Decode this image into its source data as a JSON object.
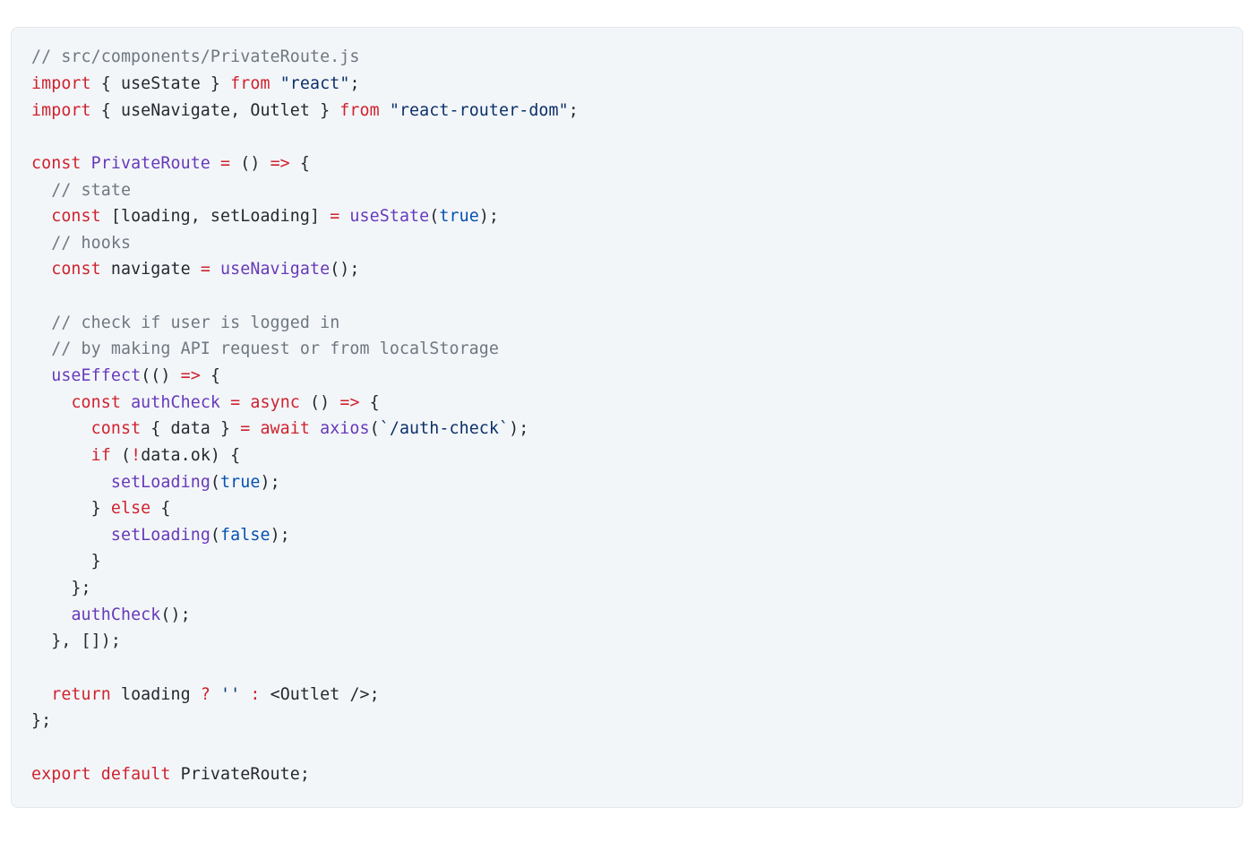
{
  "code": {
    "lines": [
      [
        {
          "cls": "tok-comment",
          "text": "// src/components/PrivateRoute.js"
        }
      ],
      [
        {
          "cls": "tok-keyword",
          "text": "import"
        },
        {
          "cls": "tok-plain",
          "text": " { useState } "
        },
        {
          "cls": "tok-keyword",
          "text": "from"
        },
        {
          "cls": "tok-plain",
          "text": " "
        },
        {
          "cls": "tok-string",
          "text": "\"react\""
        },
        {
          "cls": "tok-plain",
          "text": ";"
        }
      ],
      [
        {
          "cls": "tok-keyword",
          "text": "import"
        },
        {
          "cls": "tok-plain",
          "text": " { useNavigate, Outlet } "
        },
        {
          "cls": "tok-keyword",
          "text": "from"
        },
        {
          "cls": "tok-plain",
          "text": " "
        },
        {
          "cls": "tok-string",
          "text": "\"react-router-dom\""
        },
        {
          "cls": "tok-plain",
          "text": ";"
        }
      ],
      [
        {
          "cls": "tok-plain",
          "text": ""
        }
      ],
      [
        {
          "cls": "tok-keyword",
          "text": "const"
        },
        {
          "cls": "tok-plain",
          "text": " "
        },
        {
          "cls": "tok-func",
          "text": "PrivateRoute"
        },
        {
          "cls": "tok-plain",
          "text": " "
        },
        {
          "cls": "tok-op",
          "text": "="
        },
        {
          "cls": "tok-plain",
          "text": " () "
        },
        {
          "cls": "tok-op",
          "text": "=>"
        },
        {
          "cls": "tok-plain",
          "text": " {"
        }
      ],
      [
        {
          "cls": "tok-plain",
          "text": "  "
        },
        {
          "cls": "tok-comment",
          "text": "// state"
        }
      ],
      [
        {
          "cls": "tok-plain",
          "text": "  "
        },
        {
          "cls": "tok-keyword",
          "text": "const"
        },
        {
          "cls": "tok-plain",
          "text": " [loading, setLoading] "
        },
        {
          "cls": "tok-op",
          "text": "="
        },
        {
          "cls": "tok-plain",
          "text": " "
        },
        {
          "cls": "tok-func",
          "text": "useState"
        },
        {
          "cls": "tok-plain",
          "text": "("
        },
        {
          "cls": "tok-const",
          "text": "true"
        },
        {
          "cls": "tok-plain",
          "text": ");"
        }
      ],
      [
        {
          "cls": "tok-plain",
          "text": "  "
        },
        {
          "cls": "tok-comment",
          "text": "// hooks"
        }
      ],
      [
        {
          "cls": "tok-plain",
          "text": "  "
        },
        {
          "cls": "tok-keyword",
          "text": "const"
        },
        {
          "cls": "tok-plain",
          "text": " navigate "
        },
        {
          "cls": "tok-op",
          "text": "="
        },
        {
          "cls": "tok-plain",
          "text": " "
        },
        {
          "cls": "tok-func",
          "text": "useNavigate"
        },
        {
          "cls": "tok-plain",
          "text": "();"
        }
      ],
      [
        {
          "cls": "tok-plain",
          "text": ""
        }
      ],
      [
        {
          "cls": "tok-plain",
          "text": "  "
        },
        {
          "cls": "tok-comment",
          "text": "// check if user is logged in"
        }
      ],
      [
        {
          "cls": "tok-plain",
          "text": "  "
        },
        {
          "cls": "tok-comment",
          "text": "// by making API request or from localStorage"
        }
      ],
      [
        {
          "cls": "tok-plain",
          "text": "  "
        },
        {
          "cls": "tok-func",
          "text": "useEffect"
        },
        {
          "cls": "tok-plain",
          "text": "(() "
        },
        {
          "cls": "tok-op",
          "text": "=>"
        },
        {
          "cls": "tok-plain",
          "text": " {"
        }
      ],
      [
        {
          "cls": "tok-plain",
          "text": "    "
        },
        {
          "cls": "tok-keyword",
          "text": "const"
        },
        {
          "cls": "tok-plain",
          "text": " "
        },
        {
          "cls": "tok-func",
          "text": "authCheck"
        },
        {
          "cls": "tok-plain",
          "text": " "
        },
        {
          "cls": "tok-op",
          "text": "="
        },
        {
          "cls": "tok-plain",
          "text": " "
        },
        {
          "cls": "tok-keyword",
          "text": "async"
        },
        {
          "cls": "tok-plain",
          "text": " () "
        },
        {
          "cls": "tok-op",
          "text": "=>"
        },
        {
          "cls": "tok-plain",
          "text": " {"
        }
      ],
      [
        {
          "cls": "tok-plain",
          "text": "      "
        },
        {
          "cls": "tok-keyword",
          "text": "const"
        },
        {
          "cls": "tok-plain",
          "text": " { data } "
        },
        {
          "cls": "tok-op",
          "text": "="
        },
        {
          "cls": "tok-plain",
          "text": " "
        },
        {
          "cls": "tok-keyword",
          "text": "await"
        },
        {
          "cls": "tok-plain",
          "text": " "
        },
        {
          "cls": "tok-func",
          "text": "axios"
        },
        {
          "cls": "tok-plain",
          "text": "("
        },
        {
          "cls": "tok-string",
          "text": "`/auth-check`"
        },
        {
          "cls": "tok-plain",
          "text": ");"
        }
      ],
      [
        {
          "cls": "tok-plain",
          "text": "      "
        },
        {
          "cls": "tok-keyword",
          "text": "if"
        },
        {
          "cls": "tok-plain",
          "text": " ("
        },
        {
          "cls": "tok-op",
          "text": "!"
        },
        {
          "cls": "tok-plain",
          "text": "data.ok) {"
        }
      ],
      [
        {
          "cls": "tok-plain",
          "text": "        "
        },
        {
          "cls": "tok-func",
          "text": "setLoading"
        },
        {
          "cls": "tok-plain",
          "text": "("
        },
        {
          "cls": "tok-const",
          "text": "true"
        },
        {
          "cls": "tok-plain",
          "text": ");"
        }
      ],
      [
        {
          "cls": "tok-plain",
          "text": "      } "
        },
        {
          "cls": "tok-keyword",
          "text": "else"
        },
        {
          "cls": "tok-plain",
          "text": " {"
        }
      ],
      [
        {
          "cls": "tok-plain",
          "text": "        "
        },
        {
          "cls": "tok-func",
          "text": "setLoading"
        },
        {
          "cls": "tok-plain",
          "text": "("
        },
        {
          "cls": "tok-const",
          "text": "false"
        },
        {
          "cls": "tok-plain",
          "text": ");"
        }
      ],
      [
        {
          "cls": "tok-plain",
          "text": "      }"
        }
      ],
      [
        {
          "cls": "tok-plain",
          "text": "    };"
        }
      ],
      [
        {
          "cls": "tok-plain",
          "text": "    "
        },
        {
          "cls": "tok-func",
          "text": "authCheck"
        },
        {
          "cls": "tok-plain",
          "text": "();"
        }
      ],
      [
        {
          "cls": "tok-plain",
          "text": "  }, []);"
        }
      ],
      [
        {
          "cls": "tok-plain",
          "text": ""
        }
      ],
      [
        {
          "cls": "tok-plain",
          "text": "  "
        },
        {
          "cls": "tok-keyword",
          "text": "return"
        },
        {
          "cls": "tok-plain",
          "text": " loading "
        },
        {
          "cls": "tok-op",
          "text": "?"
        },
        {
          "cls": "tok-plain",
          "text": " "
        },
        {
          "cls": "tok-string",
          "text": "''"
        },
        {
          "cls": "tok-plain",
          "text": " "
        },
        {
          "cls": "tok-op",
          "text": ":"
        },
        {
          "cls": "tok-plain",
          "text": " <Outlet />;"
        }
      ],
      [
        {
          "cls": "tok-plain",
          "text": "};"
        }
      ],
      [
        {
          "cls": "tok-plain",
          "text": ""
        }
      ],
      [
        {
          "cls": "tok-keyword",
          "text": "export"
        },
        {
          "cls": "tok-plain",
          "text": " "
        },
        {
          "cls": "tok-keyword",
          "text": "default"
        },
        {
          "cls": "tok-plain",
          "text": " PrivateRoute;"
        }
      ]
    ]
  }
}
